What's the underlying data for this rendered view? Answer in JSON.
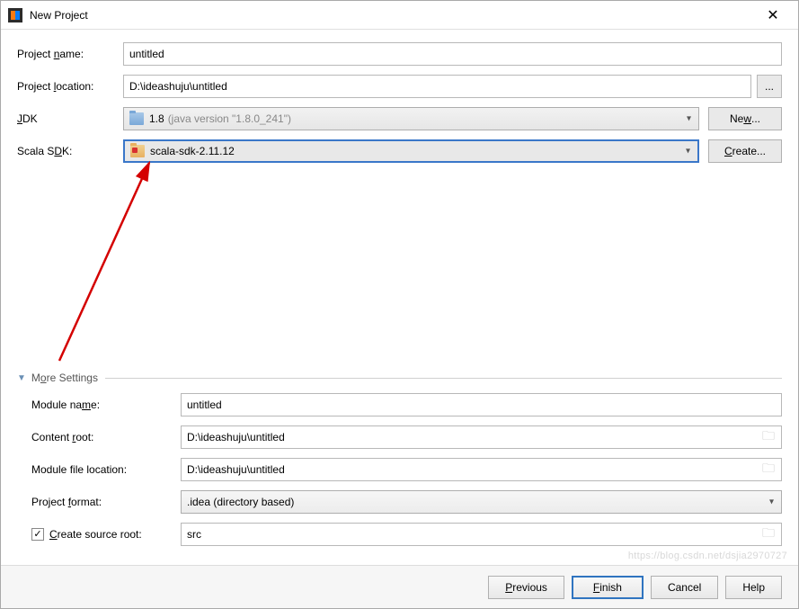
{
  "window": {
    "title": "New Project"
  },
  "labels": {
    "projectName": "Project name:",
    "projectLocation": "Project location:",
    "jdk": "JDK",
    "scalaSdk": "Scala SDK:",
    "moreSettings": "More Settings",
    "moduleName": "Module name:",
    "contentRoot": "Content root:",
    "moduleFileLocation": "Module file location:",
    "projectFormat": "Project format:",
    "createSourceRoot": "Create source root:"
  },
  "values": {
    "projectName": "untitled",
    "projectLocation": "D:\\ideashuju\\untitled",
    "jdkName": "1.8",
    "jdkDetail": "(java version \"1.8.0_241\")",
    "scalaSdk": "scala-sdk-2.11.12",
    "moduleName": "untitled",
    "contentRoot": "D:\\ideashuju\\untitled",
    "moduleFileLocation": "D:\\ideashuju\\untitled",
    "projectFormat": ".idea (directory based)",
    "sourceRoot": "src",
    "createSourceRootChecked": true
  },
  "buttons": {
    "browse": "...",
    "new": "New...",
    "create": "Create...",
    "previous": "Previous",
    "finish": "Finish",
    "cancel": "Cancel",
    "help": "Help"
  },
  "watermark": "https://blog.csdn.net/dsjia2970727"
}
